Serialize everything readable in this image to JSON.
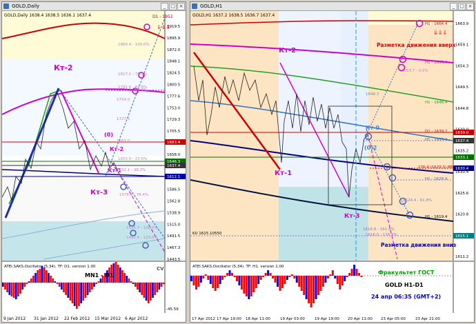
{
  "left": {
    "window_title": "GOLD,Daily",
    "quote": "GOLD,Daily  1638.4 1638.5 1636.1 1637.4",
    "labels": {
      "kt2": "Кт-2",
      "kt3": "Кт-3",
      "kt1": "Кт-1",
      "kt2b": "Кт-2",
      "p0": "(0)",
      "d1": "D1 - 1952"
    },
    "price_ticks": [
      "1919.5",
      "1895.9",
      "1872.0",
      "1848.1",
      "1824.5",
      "1800.5",
      "1777.6",
      "1753.0",
      "1729.3",
      "1705.5",
      "1681.8",
      "1658.0",
      "1634.1",
      "1610.3",
      "1586.5",
      "1562.8",
      "1538.9",
      "1515.0",
      "1491.5",
      "1467.3",
      "1443.5"
    ],
    "date_ticks": [
      "9 Jan 2012",
      "31 Jan 2012",
      "22 Feb 2012",
      "15 Mar 2012",
      "6 Apr 2012"
    ],
    "price_boxes": [
      "1683.4",
      "1646.3",
      "1637.4",
      "1612.1"
    ],
    "fib_labels": [
      "1860.4 - 100.0%",
      "1817.1 - 76.4%",
      "1791.6 - 61.8%",
      "1772.1 - 50.0%",
      "1754.0",
      "1727.5",
      "1687.0",
      "1653.0 - 23.6%",
      "1632.1 - 38.2%",
      "1576.8 - 76.4%",
      "1525.7 - 100.0%",
      "1491.6 - 123.6%"
    ],
    "osc_title": "ATEI.SAKS.Oscillator (5,34). TF: D1. version 1.00",
    "osc_center": "MN1 - D1",
    "osc_cv": "CV",
    "osc_tick": "-45.59"
  },
  "right": {
    "window_title": "GOLD,H1",
    "quote": "GOLD,H1  1637.2 1638.5 1636.7 1637.4",
    "labels": {
      "kt2": "Кт-2",
      "kt1": "Кт-1",
      "kt3": "Кт-3",
      "kt0": "Кт-0",
      "p2": "(0)2",
      "up": "Разметка движения вверх",
      "down": "Разметка движения вниз",
      "ku": "KU 1615.10550"
    },
    "price_ticks": [
      "1663.9",
      "1659.1",
      "1654.3",
      "1649.5",
      "1644.8",
      "1640.0",
      "1635.2",
      "1630.4",
      "1625.6",
      "1620.8",
      "1616.0",
      "1611.2"
    ],
    "date_ticks": [
      "17 Apr 2012",
      "17 Apr 19:00",
      "18 Apr 11:00",
      "19 Apr 03:00",
      "19 Apr 19:00",
      "20 Apr 11:00",
      "23 Apr 05:00",
      "23 Apr 21:00"
    ],
    "price_boxes": [
      "1639.0",
      "1637.4",
      "1633.1",
      "1630.4",
      "1615.1"
    ],
    "level_labels": [
      "H1 - 1664.4",
      "H1 - 1655.4",
      "1653.7 - 0.0%",
      "H1 - 1646.4",
      "1648.3",
      "D1 - 1639.2",
      "H1 - 1637.4",
      "176.4 (1629.3) MN1",
      "H1 - 1628.4",
      "1624.4 - 61.8%",
      "H1 - 1619.4",
      "1616.8 - 161.8%",
      "1616.0 - 176.4%"
    ],
    "osc_title": "ATEI.SAKS.Oscillator (5,34). TF: H1. version 1.00",
    "osc_text1": "Фракультет ГОСТ",
    "osc_text2": "GOLD   H1-D1",
    "osc_text3": "24 апр 06:35  (GMT+2)"
  },
  "colors": {
    "kt": "#d000d0",
    "blue_note": "#0000cc",
    "up_text": "#e00000",
    "fakultet": "#00a000",
    "osc_red": "#ff0000",
    "osc_blue": "#0000ff"
  }
}
